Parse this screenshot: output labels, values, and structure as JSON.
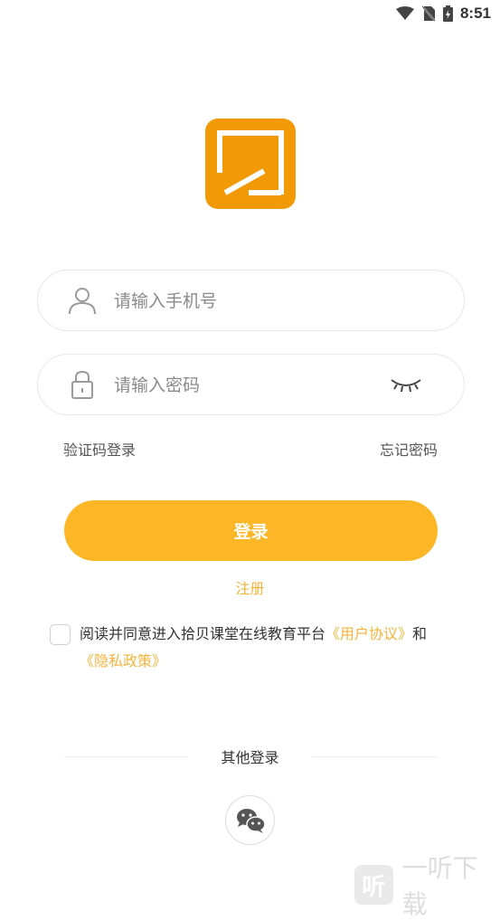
{
  "status_bar": {
    "time": "8:51"
  },
  "login_form": {
    "phone_placeholder": "请输入手机号",
    "password_placeholder": "请输入密码",
    "sms_login_label": "验证码登录",
    "forgot_password_label": "忘记密码",
    "login_button_label": "登录",
    "register_label": "注册"
  },
  "agreement": {
    "text": "阅读并同意进入拾贝课堂在线教育平台",
    "user_agreement": "《用户协议》",
    "and": "和",
    "privacy_policy": "《隐私政策》"
  },
  "other_login": {
    "label": "其他登录"
  },
  "watermark": {
    "icon_text": "听",
    "text": "一听下载"
  },
  "colors": {
    "accent": "#FDB726",
    "logo": "#F29A05",
    "link": "#F7B33A"
  }
}
